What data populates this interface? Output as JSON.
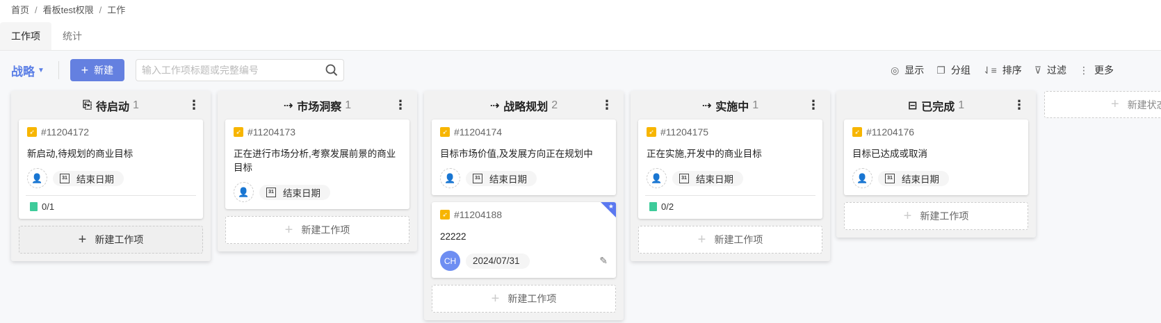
{
  "breadcrumb": [
    "首页",
    "看板test权限",
    "工作"
  ],
  "tabs": [
    "工作项",
    "统计"
  ],
  "toolbar": {
    "view": "战略",
    "new": "新建",
    "search_placeholder": "输入工作项标题或完整编号",
    "tools": [
      {
        "icon": "eye-icon",
        "glyph": "◎",
        "label": "显示"
      },
      {
        "icon": "group-icon",
        "glyph": "❐",
        "label": "分组"
      },
      {
        "icon": "sort-icon",
        "glyph": "⇃≡",
        "label": "排序"
      },
      {
        "icon": "filter-icon",
        "glyph": "⊽",
        "label": "过滤"
      },
      {
        "icon": "more-icon",
        "glyph": "⋮",
        "label": "更多"
      }
    ]
  },
  "add_item_label": "新建工作项",
  "new_status_label": "新建状态",
  "columns": [
    {
      "title": "待启动",
      "count": "1",
      "icon": "⎘",
      "cards": [
        {
          "id": "#11204172",
          "title": "新启动,待规划的商业目标",
          "date": "结束日期",
          "subtask": "0/1"
        }
      ]
    },
    {
      "title": "市场洞察",
      "count": "1",
      "icon": "⇢",
      "cards": [
        {
          "id": "#11204173",
          "title": "正在进行市场分析,考察发展前景的商业目标",
          "date": "结束日期"
        }
      ]
    },
    {
      "title": "战略规划",
      "count": "2",
      "icon": "⇢",
      "cards": [
        {
          "id": "#11204174",
          "title": "目标市场价值,及发展方向正在规划中",
          "date": "结束日期"
        },
        {
          "id": "#11204188",
          "title": "22222",
          "date": "2024/07/31",
          "assignee": "CH",
          "starred": true
        }
      ]
    },
    {
      "title": "实施中",
      "count": "1",
      "icon": "⇢",
      "cards": [
        {
          "id": "#11204175",
          "title": "正在实施,开发中的商业目标",
          "date": "结束日期",
          "subtask": "0/2"
        }
      ]
    },
    {
      "title": "已完成",
      "count": "1",
      "icon": "⊟",
      "cards": [
        {
          "id": "#11204176",
          "title": "目标已达成或取消",
          "date": "结束日期"
        }
      ]
    }
  ]
}
